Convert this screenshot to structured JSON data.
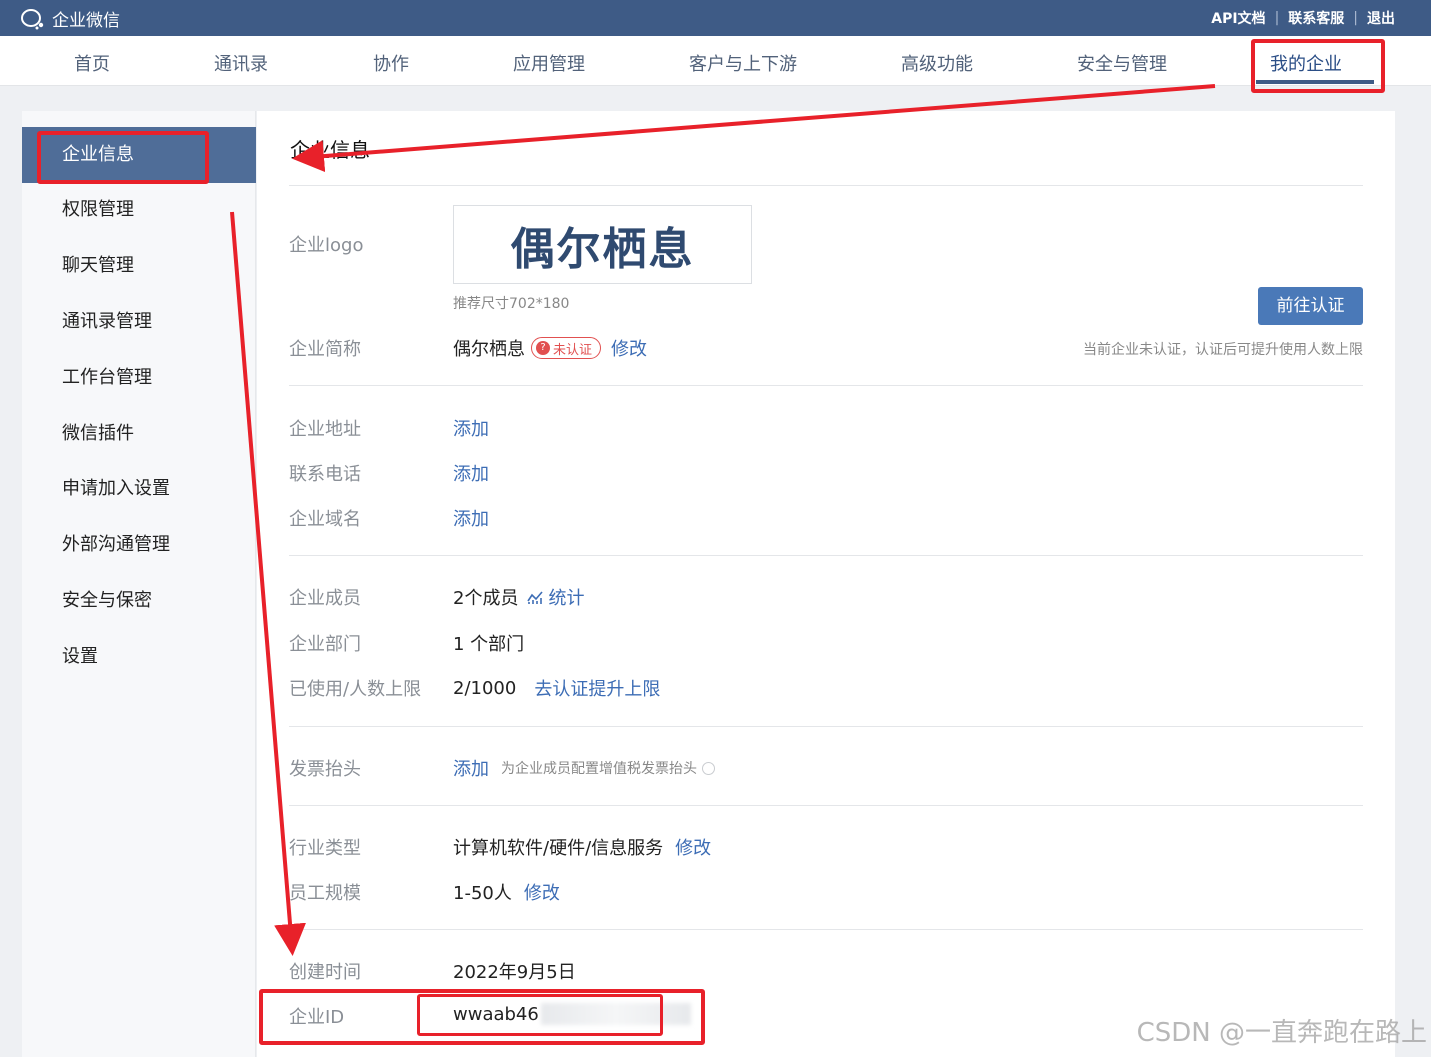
{
  "header": {
    "brand": "企业微信",
    "links": [
      "API文档",
      "联系客服",
      "退出"
    ]
  },
  "nav": {
    "tabs": [
      {
        "label": "首页",
        "active": false
      },
      {
        "label": "通讯录",
        "active": false
      },
      {
        "label": "协作",
        "active": false
      },
      {
        "label": "应用管理",
        "active": false
      },
      {
        "label": "客户与上下游",
        "active": false
      },
      {
        "label": "高级功能",
        "active": false
      },
      {
        "label": "安全与管理",
        "active": false
      },
      {
        "label": "我的企业",
        "active": true
      }
    ]
  },
  "sidebar": {
    "items": [
      {
        "label": "企业信息",
        "active": true
      },
      {
        "label": "权限管理"
      },
      {
        "label": "聊天管理"
      },
      {
        "label": "通讯录管理"
      },
      {
        "label": "工作台管理"
      },
      {
        "label": "微信插件"
      },
      {
        "label": "申请加入设置"
      },
      {
        "label": "外部沟通管理"
      },
      {
        "label": "安全与保密"
      },
      {
        "label": "设置"
      }
    ]
  },
  "main": {
    "title": "企业信息",
    "logo": {
      "label": "企业logo",
      "text": "偶尔栖息",
      "note": "推荐尺寸702*180"
    },
    "certify_button": "前往认证",
    "certify_note": "当前企业未认证，认证后可提升使用人数上限",
    "short_name": {
      "label": "企业简称",
      "value": "偶尔栖息",
      "badge_icon": "?",
      "badge": "未认证",
      "action": "修改"
    },
    "address": {
      "label": "企业地址",
      "action": "添加"
    },
    "phone": {
      "label": "联系电话",
      "action": "添加"
    },
    "domain": {
      "label": "企业域名",
      "action": "添加"
    },
    "members": {
      "label": "企业成员",
      "value": "2个成员",
      "action": "统计"
    },
    "departments": {
      "label": "企业部门",
      "value": "1 个部门"
    },
    "usage": {
      "label": "已使用/人数上限",
      "value": "2/1000",
      "action": "去认证提升上限"
    },
    "invoice": {
      "label": "发票抬头",
      "action": "添加",
      "note": "为企业成员配置增值税发票抬头"
    },
    "industry": {
      "label": "行业类型",
      "value": "计算机软件/硬件/信息服务",
      "action": "修改"
    },
    "scale": {
      "label": "员工规模",
      "value": "1-50人",
      "action": "修改"
    },
    "created": {
      "label": "创建时间",
      "value": "2022年9月5日"
    },
    "corp_id": {
      "label": "企业ID",
      "value": "wwaab46"
    }
  },
  "watermark": "CSDN @一直奔跑在路上",
  "colors": {
    "header_bg": "#3e5b86",
    "sidebar_active": "#4f6d98",
    "link": "#3d6db5",
    "annotation": "#e8212a"
  }
}
